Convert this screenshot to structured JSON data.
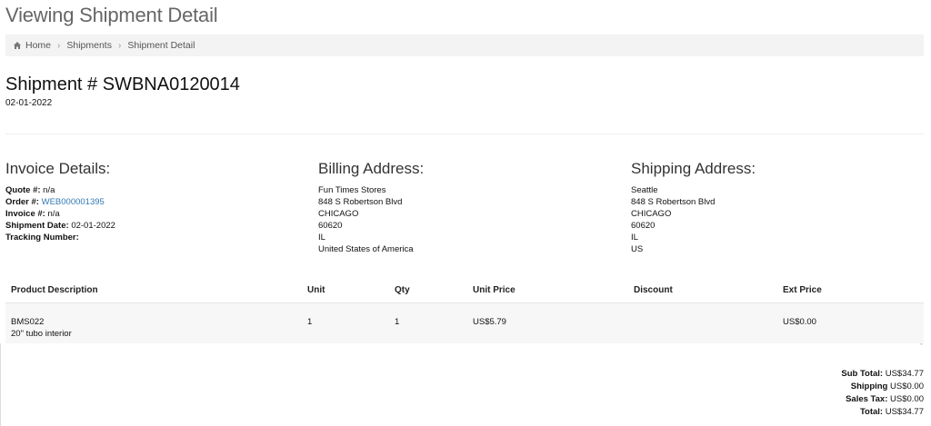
{
  "page_title": "Viewing Shipment Detail",
  "breadcrumb": {
    "home": "Home",
    "shipments": "Shipments",
    "current": "Shipment Detail",
    "separator": "›"
  },
  "shipment": {
    "title": "Shipment # SWBNA0120014",
    "date": "02-01-2022"
  },
  "invoice": {
    "heading": "Invoice Details:",
    "quote_label": "Quote #:",
    "quote_value": "n/a",
    "order_label": "Order #:",
    "order_value": "WEB000001395",
    "invoice_label": "Invoice #:",
    "invoice_value": "n/a",
    "shipment_date_label": "Shipment Date:",
    "shipment_date_value": "02-01-2022",
    "tracking_label": "Tracking Number:",
    "tracking_value": ""
  },
  "billing": {
    "heading": "Billing Address:",
    "lines": [
      "Fun Times Stores",
      "848 S Robertson Blvd",
      "CHICAGO",
      "60620",
      "IL",
      "United States of America"
    ]
  },
  "shipping": {
    "heading": "Shipping Address:",
    "lines": [
      "Seattle",
      "848 S Robertson Blvd",
      "CHICAGO",
      "60620",
      "IL",
      "US"
    ]
  },
  "table": {
    "headers": [
      "Product Description",
      "Unit",
      "Qty",
      "Unit Price",
      "Discount",
      "Ext Price"
    ],
    "rows": [
      {
        "sku": "BMS022",
        "description": "20\" tubo interior",
        "unit": "1",
        "qty": "1",
        "unit_price": "US$5.79",
        "discount": "",
        "ext_price": "US$0.00"
      }
    ]
  },
  "totals": {
    "subtotal_label": "Sub Total:",
    "subtotal_value": "US$34.77",
    "shipping_label": "Shipping",
    "shipping_value": "US$0.00",
    "tax_label": "Sales Tax:",
    "tax_value": "US$0.00",
    "total_label": "Total:",
    "total_value": "US$34.77"
  },
  "colors": {
    "link": "#337ab7",
    "breadcrumb_bg": "#f3f3f3",
    "row_bg": "#f7f7f7"
  },
  "icons": {
    "breadcrumb_home": "home-icon"
  }
}
